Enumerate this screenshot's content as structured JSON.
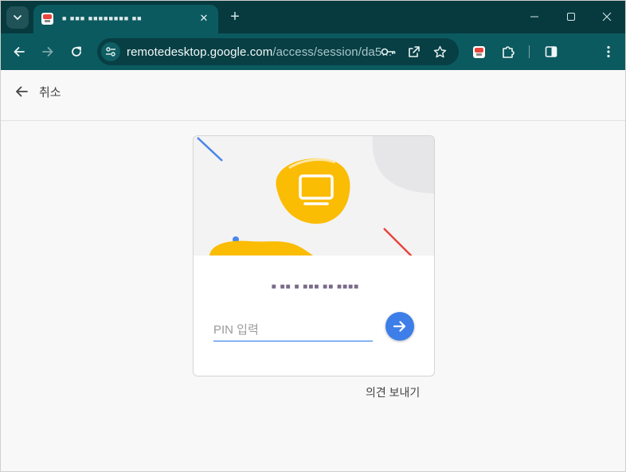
{
  "browser": {
    "tab": {
      "title": "■ ■■■ ■■■■■■■■ ■■",
      "favicon": "chrome-remote-desktop-icon",
      "close_label": "✕"
    },
    "new_tab_label": "+",
    "window_controls": [
      "minimize-icon",
      "maximize-icon",
      "close-icon"
    ],
    "toolbar": {
      "url_host": "remotedesktop.google.com",
      "url_path": "/access/session/da5...",
      "icons": [
        "back-arrow-icon",
        "forward-arrow-icon",
        "reload-icon",
        "site-info-icon",
        "key-icon",
        "open-in-app-icon",
        "star-icon",
        "extension-icon",
        "side-panel-icon",
        "more-menu-icon"
      ]
    }
  },
  "page": {
    "cancel_label": "취소",
    "hostname": "■ ■■ ■ ■■■ ■■ ■■■■",
    "pin_placeholder": "PIN 입력",
    "pin_value": "",
    "feedback_label": "의견 보내기"
  },
  "colors": {
    "tab_strip": "#063a3f",
    "toolbar": "#0b5a5f",
    "accent_blue": "#3d7ee8",
    "hero_yellow": "#fbbc04",
    "hero_red": "#ea4335"
  }
}
